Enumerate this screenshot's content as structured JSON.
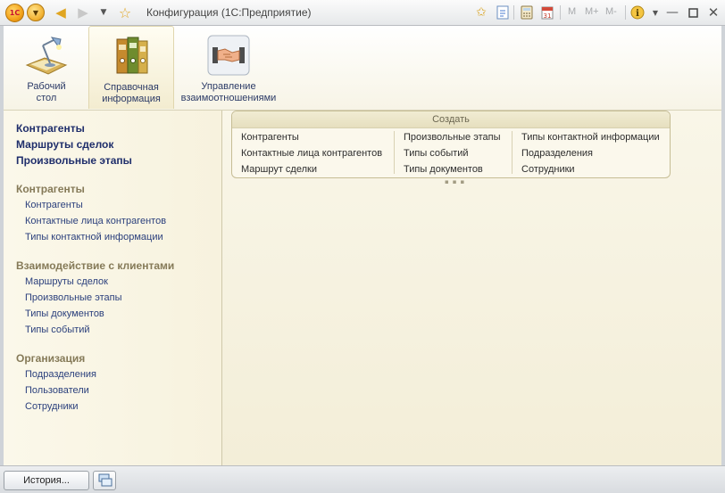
{
  "window": {
    "title": "Конфигурация  (1С:Предприятие)",
    "logo_text": "1С",
    "m_labels": [
      "M",
      "M+",
      "M-"
    ]
  },
  "toolbar_icons": [
    "app-logo-icon",
    "main-menu-icon",
    "back-arrow-icon",
    "forward-arrow-icon",
    "history-dropdown-icon",
    "favorites-star-icon",
    "add-favorite-icon",
    "links-icon",
    "calculator-icon",
    "calendar-icon",
    "info-icon",
    "minimize-icon",
    "restore-icon",
    "close-icon"
  ],
  "calendar_day": "31",
  "sections": [
    {
      "id": "desktop",
      "label_lines": [
        "Рабочий",
        "стол"
      ],
      "icon": "desk-lamp-icon"
    },
    {
      "id": "reference",
      "label_lines": [
        "Справочная",
        "информация"
      ],
      "icon": "binders-icon",
      "active": true
    },
    {
      "id": "relations",
      "label_lines": [
        "Управление",
        "взаимоотношениями"
      ],
      "icon": "handshake-icon"
    }
  ],
  "nav": {
    "pinned": [
      "Контрагенты",
      "Маршруты сделок",
      "Произвольные этапы"
    ],
    "groups": [
      {
        "title": "Контрагенты",
        "items": [
          "Контрагенты",
          "Контактные лица контрагентов",
          "Типы контактной информации"
        ]
      },
      {
        "title": "Взаимодействие с клиентами",
        "items": [
          "Маршруты сделок",
          "Произвольные этапы",
          "Типы документов",
          "Типы событий"
        ]
      },
      {
        "title": "Организация",
        "items": [
          "Подразделения",
          "Пользователи",
          "Сотрудники"
        ]
      }
    ]
  },
  "create_panel": {
    "title": "Создать",
    "columns": [
      [
        "Контрагенты",
        "Контактные лица контрагентов",
        "Маршрут сделки"
      ],
      [
        "Произвольные этапы",
        "Типы событий",
        "Типы документов"
      ],
      [
        "Типы контактной информации",
        "Подразделения",
        "Сотрудники"
      ]
    ]
  },
  "bottom": {
    "history_label": "История..."
  },
  "colors": {
    "accent_link": "#2a3f7c",
    "group_title": "#857a58",
    "panel_bg": "#f7f2de"
  }
}
